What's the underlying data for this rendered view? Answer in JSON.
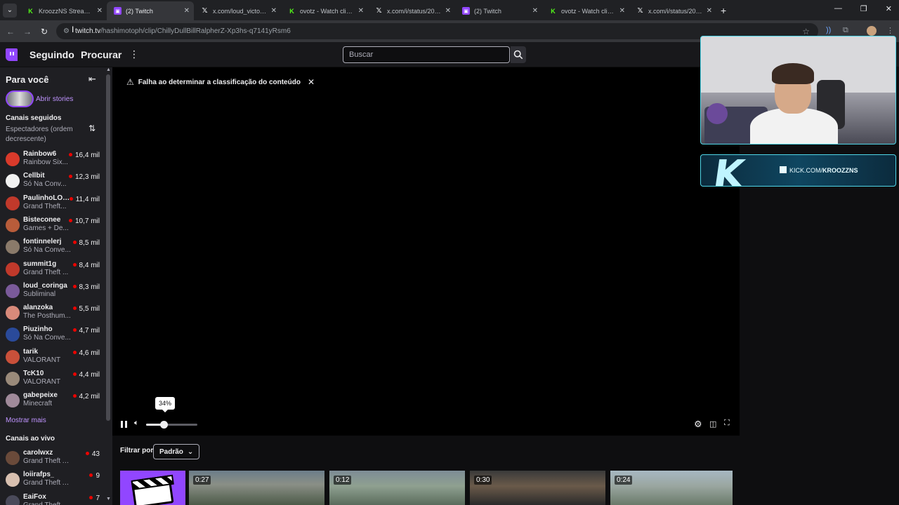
{
  "browser": {
    "tabs": [
      {
        "title": "KroozzNS Stream - W",
        "favicon": "kick",
        "active": false
      },
      {
        "title": "(2) Twitch",
        "favicon": "twitch",
        "active": true
      },
      {
        "title": "x.com/loud_victor/st",
        "favicon": "x",
        "active": false
      },
      {
        "title": "ovotz - Watch clips o",
        "favicon": "kick",
        "active": false
      },
      {
        "title": "x.com/i/status/20402",
        "favicon": "x",
        "active": false
      },
      {
        "title": "(2) Twitch",
        "favicon": "twitch",
        "active": false
      },
      {
        "title": "ovotz - Watch clips o",
        "favicon": "kick",
        "active": false
      },
      {
        "title": "x.com/i/status/20402",
        "favicon": "x",
        "active": false
      }
    ],
    "url_host": "twitch.tv",
    "url_path": "/hashimotoph/clip/ChillyDullBillRalpherZ-Xp3hs-q7141yRsm6"
  },
  "nav": {
    "following": "Seguindo",
    "browse": "Procurar",
    "search_placeholder": "Buscar"
  },
  "sidebar": {
    "title": "Para você",
    "stories_label": "Abrir stories",
    "followed_title": "Canais seguidos",
    "followed_sort": "Espectadores (ordem decrescente)",
    "followed": [
      {
        "name": "Rainbow6",
        "game": "Rainbow Six...",
        "viewers": "16,4 mil",
        "color": "#d93a2b"
      },
      {
        "name": "Cellbit",
        "game": "Só Na Conv...",
        "viewers": "12,3 mil",
        "color": "#f2f2f2"
      },
      {
        "name": "PaulinhoLOK...",
        "game": "Grand Theft...",
        "viewers": "11,4 mil",
        "color": "#c0392b"
      },
      {
        "name": "Bisteconee",
        "game": "Games + De...",
        "viewers": "10,7 mil",
        "color": "#b85c3a"
      },
      {
        "name": "fontinnelerj",
        "game": "Só Na Conve...",
        "viewers": "8,5 mil",
        "color": "#8a7a6a"
      },
      {
        "name": "summit1g",
        "game": "Grand Theft ...",
        "viewers": "8,4 mil",
        "color": "#c0392b"
      },
      {
        "name": "loud_coringa",
        "game": "Subliminal",
        "viewers": "8,3 mil",
        "color": "#7a5a9a"
      },
      {
        "name": "alanzoka",
        "game": "The Posthum...",
        "viewers": "5,5 mil",
        "color": "#d88a7a"
      },
      {
        "name": "Piuzinho",
        "game": "Só Na Conve...",
        "viewers": "4,7 mil",
        "color": "#2a4a9a"
      },
      {
        "name": "tarik",
        "game": "VALORANT",
        "viewers": "4,6 mil",
        "color": "#c9503a"
      },
      {
        "name": "TcK10",
        "game": "VALORANT",
        "viewers": "4,4 mil",
        "color": "#9a8a7a"
      },
      {
        "name": "gabepeixe",
        "game": "Minecraft",
        "viewers": "4,2 mil",
        "color": "#a08a9a"
      }
    ],
    "show_more": "Mostrar mais",
    "live_title": "Canais ao vivo",
    "live": [
      {
        "name": "carolwxz",
        "game": "Grand Theft Au...",
        "viewers": "43",
        "color": "#6a4a3a"
      },
      {
        "name": "loiirafps_",
        "game": "Grand Theft Au...",
        "viewers": "9",
        "color": "#d8c0b0"
      },
      {
        "name": "EaiFox",
        "game": "Grand Theft Au...",
        "viewers": "7",
        "color": "#4a4a5a"
      }
    ]
  },
  "player": {
    "warning": "Falha ao determinar a classificação do conteúdo",
    "volume_tooltip": "34%",
    "volume_fraction": 0.34
  },
  "clips": {
    "filter_label": "Filtrar por",
    "filter_value": "Padrão",
    "durations": [
      "0:27",
      "0:12",
      "0:30",
      "0:24"
    ]
  },
  "overlay": {
    "kick_url_prefix": "KICK.COM/",
    "kick_url_name": "KROOZZNS",
    "kick_letter": "K"
  }
}
